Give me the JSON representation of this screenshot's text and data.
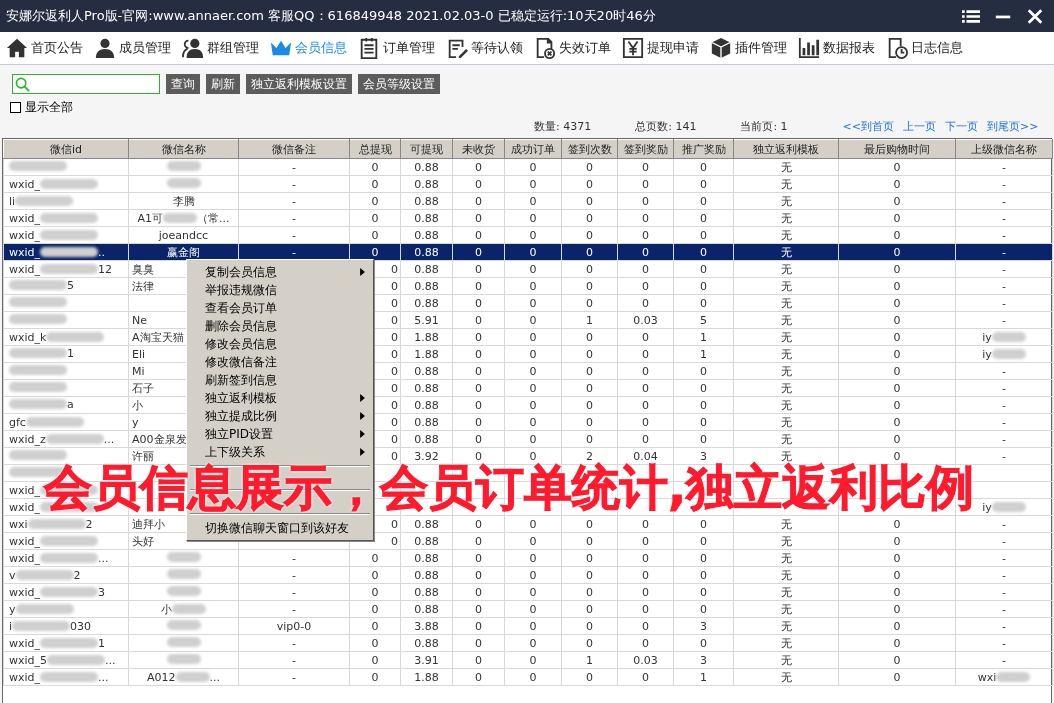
{
  "window": {
    "title": "安娜尔返利人Pro版-官网:www.annaer.com 客服QQ：616849948   2021.02.03-0   已稳定运行:10天20时46分"
  },
  "nav": [
    {
      "label": "首页公告",
      "selected": false
    },
    {
      "label": "成员管理",
      "selected": false
    },
    {
      "label": "群组管理",
      "selected": false
    },
    {
      "label": "会员信息",
      "selected": true
    },
    {
      "label": "订单管理",
      "selected": false
    },
    {
      "label": "等待认领",
      "selected": false
    },
    {
      "label": "失效订单",
      "selected": false
    },
    {
      "label": "提现申请",
      "selected": false
    },
    {
      "label": "插件管理",
      "selected": false
    },
    {
      "label": "数据报表",
      "selected": false
    },
    {
      "label": "日志信息",
      "selected": false
    }
  ],
  "toolbar": {
    "buttons": [
      "查询",
      "刷新",
      "独立返利模板设置",
      "会员等级设置"
    ],
    "show_all": {
      "label": "显示全部",
      "checked": false
    }
  },
  "stats": {
    "count": "数量: 4371",
    "pages": "总页数: 141",
    "current": "当前页: 1",
    "links": [
      "<<到首页",
      "上一页",
      "下一页",
      "到尾页>>"
    ]
  },
  "table": {
    "columns": [
      "微信id",
      "微信名称",
      "微信备注",
      "总提现",
      "可提现",
      "未收货",
      "成功订单",
      "签到次数",
      "签到奖励",
      "推广奖励",
      "独立返利模板",
      "最后购物时间",
      "上级微信名称"
    ],
    "rows": [
      {
        "id": {
          "masked": true
        },
        "name": {
          "masked": true
        },
        "note": "-",
        "values": [
          "0",
          "0.88",
          "0",
          "0",
          "0",
          "0",
          "0"
        ],
        "template": "无",
        "last_buy": "0",
        "parent": {
          "text": "-"
        },
        "selected": false
      },
      {
        "id": {
          "text": "wxid_",
          "masked": true
        },
        "name": {
          "masked": true
        },
        "note": "-",
        "values": [
          "0",
          "0.88",
          "0",
          "0",
          "0",
          "0",
          "0"
        ],
        "template": "无",
        "last_buy": "0",
        "parent": {
          "text": "-"
        },
        "selected": false
      },
      {
        "id": {
          "text": "li",
          "masked": true
        },
        "name": {
          "text": "李腾"
        },
        "note": "-",
        "values": [
          "0",
          "0.88",
          "0",
          "0",
          "0",
          "0",
          "0"
        ],
        "template": "无",
        "last_buy": "0",
        "parent": {
          "text": "-"
        },
        "selected": false
      },
      {
        "id": {
          "text": "wxid_",
          "masked": true
        },
        "name": {
          "text": "A1可",
          "masked": true,
          "tail": "（常..."
        },
        "note": "-",
        "values": [
          "0",
          "0.88",
          "0",
          "0",
          "0",
          "0",
          "0"
        ],
        "template": "无",
        "last_buy": "0",
        "parent": {
          "text": "-"
        },
        "selected": false
      },
      {
        "id": {
          "text": "wxid_",
          "masked": true
        },
        "name": {
          "text": "joeandcc"
        },
        "note": "-",
        "values": [
          "0",
          "0.88",
          "0",
          "0",
          "0",
          "0",
          "0"
        ],
        "template": "无",
        "last_buy": "0",
        "parent": {
          "text": "-"
        },
        "selected": false
      },
      {
        "id": {
          "text": "wxid_",
          "masked": true,
          "tail": ".."
        },
        "name": {
          "text": "赢金阁"
        },
        "note": "-",
        "values": [
          "0",
          "0.88",
          "0",
          "0",
          "0",
          "0",
          "0"
        ],
        "template": "无",
        "last_buy": "0",
        "parent": {
          "text": "-"
        },
        "selected": true
      },
      {
        "id": {
          "text": "wxid_",
          "masked": true,
          "tail": "12"
        },
        "name": {
          "text": "臭臭"
        },
        "values": [
          "0",
          "0.88",
          "0",
          "0",
          "0",
          "0",
          "0"
        ],
        "template": "无",
        "last_buy": "0",
        "parent": {
          "text": "-"
        },
        "selected": false
      },
      {
        "id": {
          "masked": true,
          "tail": "5"
        },
        "name": {
          "text": "法律"
        },
        "values": [
          "0",
          "0.88",
          "0",
          "0",
          "0",
          "0",
          "0"
        ],
        "template": "无",
        "last_buy": "0",
        "parent": {
          "text": "-"
        },
        "selected": false
      },
      {
        "id": {
          "masked": true
        },
        "values": [
          "0",
          "0.88",
          "0",
          "0",
          "0",
          "0",
          "0"
        ],
        "template": "无",
        "last_buy": "0",
        "parent": {
          "text": "-"
        },
        "selected": false
      },
      {
        "id": {
          "masked": true
        },
        "name": {
          "text": "Ne"
        },
        "values": [
          "0",
          "5.91",
          "0",
          "0",
          "1",
          "0.03",
          "5"
        ],
        "template": "无",
        "last_buy": "0",
        "parent": {
          "text": "-"
        },
        "selected": false
      },
      {
        "id": {
          "text": "wxid_k",
          "masked": true
        },
        "name": {
          "text": "A淘宝天猫"
        },
        "values": [
          "0",
          "1.88",
          "0",
          "0",
          "0",
          "0",
          "1"
        ],
        "template": "无",
        "last_buy": "0",
        "parent": {
          "text": "iy",
          "masked": true
        },
        "selected": false
      },
      {
        "id": {
          "masked": true,
          "tail": "1"
        },
        "name": {
          "text": "Eli"
        },
        "values": [
          "0",
          "1.88",
          "0",
          "0",
          "0",
          "0",
          "1"
        ],
        "template": "无",
        "last_buy": "0",
        "parent": {
          "text": "iy",
          "masked": true
        },
        "selected": false
      },
      {
        "id": {
          "masked": true
        },
        "name": {
          "text": "Mi"
        },
        "values": [
          "0",
          "0.88",
          "0",
          "0",
          "0",
          "0",
          "0"
        ],
        "template": "无",
        "last_buy": "0",
        "parent": {
          "text": "-"
        },
        "selected": false
      },
      {
        "id": {
          "masked": true
        },
        "name": {
          "text": "石子"
        },
        "values": [
          "0",
          "0.88",
          "0",
          "0",
          "0",
          "0",
          "0"
        ],
        "template": "无",
        "last_buy": "0",
        "parent": {
          "text": "-"
        },
        "selected": false
      },
      {
        "id": {
          "masked": true,
          "tail": "a"
        },
        "name": {
          "text": "小"
        },
        "values": [
          "0",
          "0.88",
          "0",
          "0",
          "0",
          "0",
          "0"
        ],
        "template": "无",
        "last_buy": "0",
        "parent": {
          "text": "-"
        },
        "selected": false
      },
      {
        "id": {
          "text": "gfc",
          "masked": true
        },
        "name": {
          "text": "y"
        },
        "values": [
          "0",
          "0.88",
          "0",
          "0",
          "0",
          "0",
          "0"
        ],
        "template": "无",
        "last_buy": "0",
        "parent": {
          "text": "-"
        },
        "selected": false
      },
      {
        "id": {
          "text": "wxid_z",
          "masked": true,
          "tail": "..."
        },
        "name": {
          "text": "A00金泉发"
        },
        "values": [
          "0",
          "0.88",
          "0",
          "0",
          "0",
          "0",
          "0"
        ],
        "template": "无",
        "last_buy": "0",
        "parent": {
          "text": "-"
        },
        "selected": false
      },
      {
        "id": {
          "masked": true
        },
        "name": {
          "text": "许丽"
        },
        "values": [
          "0",
          "3.92",
          "0",
          "0",
          "2",
          "0.04",
          "3"
        ],
        "template": "无",
        "last_buy": "0",
        "parent": {
          "text": "-"
        },
        "selected": false
      },
      {
        "id": {
          "masked": true
        },
        "selected": false
      },
      {
        "id": {
          "text": "wxid_",
          "masked": true
        },
        "selected": false
      },
      {
        "id": {
          "text": "wxid_",
          "masked": true
        },
        "parent": {
          "text": "iy",
          "masked": true
        },
        "selected": false
      },
      {
        "id": {
          "text": "wxi",
          "masked": true,
          "tail": "2"
        },
        "name": {
          "text": "迪拜小"
        },
        "values": [
          "0",
          "0.88",
          "0",
          "0",
          "0",
          "0",
          "0"
        ],
        "template": "无",
        "last_buy": "0",
        "parent": {
          "text": "-"
        },
        "selected": false
      },
      {
        "id": {
          "text": "wxid_",
          "masked": true
        },
        "name": {
          "text": "头好"
        },
        "values": [
          "0",
          "0.88",
          "0",
          "0",
          "0",
          "0",
          "0"
        ],
        "template": "无",
        "last_buy": "0",
        "parent": {
          "text": "-"
        },
        "selected": false
      },
      {
        "id": {
          "text": "wxid_",
          "masked": true,
          "tail": "..."
        },
        "name": {
          "masked": true
        },
        "note": "-",
        "values": [
          "0",
          "0.88",
          "0",
          "0",
          "0",
          "0",
          "0"
        ],
        "template": "无",
        "last_buy": "0",
        "parent": {
          "text": "-"
        },
        "selected": false
      },
      {
        "id": {
          "text": "v",
          "masked": true,
          "tail": "2"
        },
        "name": {
          "masked": true
        },
        "note": "-",
        "values": [
          "0",
          "0.88",
          "0",
          "0",
          "0",
          "0",
          "0"
        ],
        "template": "无",
        "last_buy": "0",
        "parent": {
          "text": "-"
        },
        "selected": false
      },
      {
        "id": {
          "text": "wxid_",
          "masked": true,
          "tail": "3"
        },
        "name": {
          "masked": true
        },
        "note": "-",
        "values": [
          "0",
          "0.88",
          "0",
          "0",
          "0",
          "0",
          "0"
        ],
        "template": "无",
        "last_buy": "0",
        "parent": {
          "text": "-"
        },
        "selected": false
      },
      {
        "id": {
          "text": "y",
          "masked": true
        },
        "name": {
          "text": "小",
          "masked": true
        },
        "note": "-",
        "values": [
          "0",
          "0.88",
          "0",
          "0",
          "0",
          "0",
          "0"
        ],
        "template": "无",
        "last_buy": "0",
        "parent": {
          "text": "-"
        },
        "selected": false
      },
      {
        "id": {
          "text": "i",
          "masked": true,
          "tail": "030"
        },
        "name": {
          "masked": true
        },
        "note": "vip0-0",
        "values": [
          "0",
          "3.88",
          "0",
          "0",
          "0",
          "0",
          "3"
        ],
        "template": "无",
        "last_buy": "0",
        "parent": {
          "text": "-"
        },
        "selected": false
      },
      {
        "id": {
          "text": "wxid_",
          "masked": true,
          "tail": "1"
        },
        "name": {
          "masked": true
        },
        "note": "-",
        "values": [
          "0",
          "0.88",
          "0",
          "0",
          "0",
          "0",
          "0"
        ],
        "template": "无",
        "last_buy": "0",
        "parent": {
          "text": "-"
        },
        "selected": false
      },
      {
        "id": {
          "text": "wxid_5",
          "masked": true,
          "tail": "..."
        },
        "name": {
          "masked": true
        },
        "note": "-",
        "values": [
          "0",
          "3.91",
          "0",
          "0",
          "1",
          "0.03",
          "3"
        ],
        "template": "无",
        "last_buy": "0",
        "parent": {
          "text": "-"
        },
        "selected": false
      },
      {
        "id": {
          "text": "wxid_",
          "masked": true,
          "tail": "..."
        },
        "name": {
          "text": "A012",
          "masked": true,
          "tail": "..."
        },
        "note": "-",
        "values": [
          "0",
          "1.88",
          "0",
          "0",
          "0",
          "0",
          "1"
        ],
        "template": "无",
        "last_buy": "0",
        "parent": {
          "text": "wxi",
          "masked": true
        },
        "selected": false
      }
    ]
  },
  "context_menu": {
    "items": [
      {
        "kind": "item",
        "label": "复制会员信息",
        "submenu": true
      },
      {
        "kind": "item",
        "label": "举报违规微信",
        "submenu": false
      },
      {
        "kind": "item",
        "label": "查看会员订单",
        "submenu": false
      },
      {
        "kind": "item",
        "label": "删除会员信息",
        "submenu": false
      },
      {
        "kind": "item",
        "label": "修改会员信息",
        "submenu": false
      },
      {
        "kind": "item",
        "label": "修改微信备注",
        "submenu": false
      },
      {
        "kind": "item",
        "label": "刷新签到信息",
        "submenu": false
      },
      {
        "kind": "item",
        "label": "独立返利模板",
        "submenu": true
      },
      {
        "kind": "item",
        "label": "独立提成比例",
        "submenu": true
      },
      {
        "kind": "item",
        "label": "独立PID设置",
        "submenu": true
      },
      {
        "kind": "item",
        "label": "上下级关系",
        "submenu": true
      },
      {
        "kind": "separator"
      },
      {
        "kind": "gap"
      },
      {
        "kind": "separator"
      },
      {
        "kind": "gap"
      },
      {
        "kind": "separator"
      },
      {
        "kind": "item",
        "label": "切换微信聊天窗口到该好友",
        "submenu": false
      }
    ]
  },
  "caption": "会员信息展示，会员订单统计,独立返利比例"
}
